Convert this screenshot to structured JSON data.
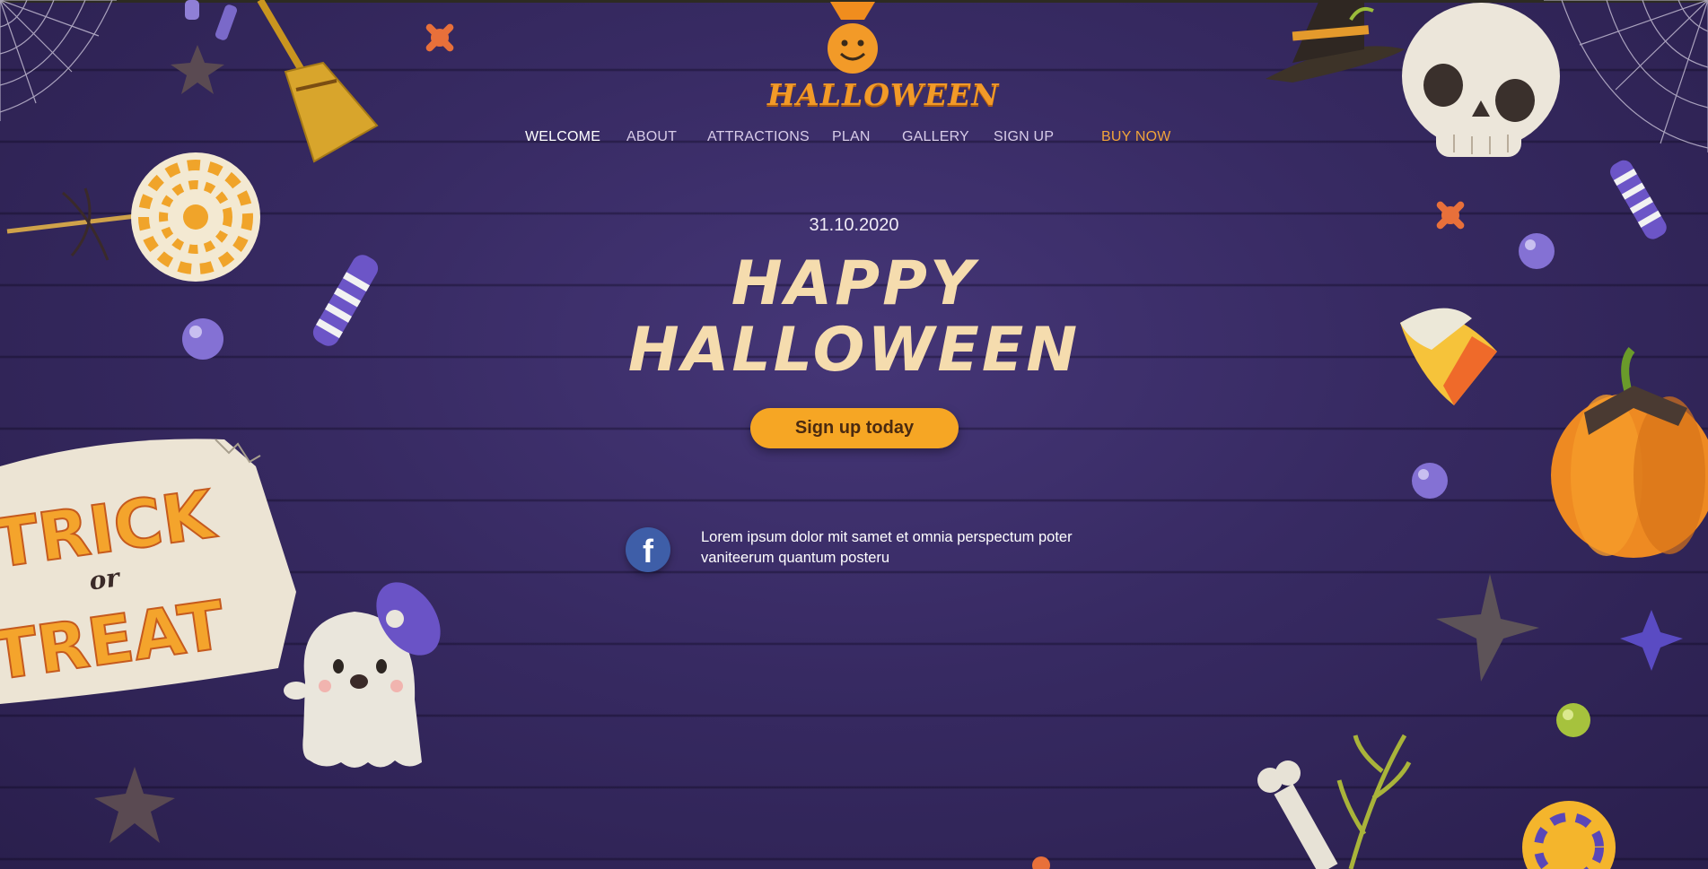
{
  "brand": {
    "logo_text": "HALLOWEEN"
  },
  "nav": {
    "items": [
      "WELCOME",
      "ABOUT",
      "ATTRACTIONS",
      "PLAN",
      "GALLERY",
      "SIGN UP"
    ],
    "buy_label": "BUY NOW"
  },
  "hero": {
    "date": "31.10.2020",
    "title_line1": "HAPPY",
    "title_line2": "HALLOWEEN",
    "cta_label": "Sign up today"
  },
  "social": {
    "icon": "facebook-icon",
    "icon_glyph": "f",
    "text": "Lorem ipsum dolor mit samet et omnia perspectum poter vaniteerum quantum posteru"
  },
  "decorations": {
    "sign_line1": "TRICK",
    "sign_line2": "or",
    "sign_line3": "TREAT"
  },
  "colors": {
    "background": "#372a62",
    "accent": "#f6a624",
    "title": "#f5dcae",
    "buy_now": "#f2a43a",
    "facebook": "#3e5ea8"
  }
}
